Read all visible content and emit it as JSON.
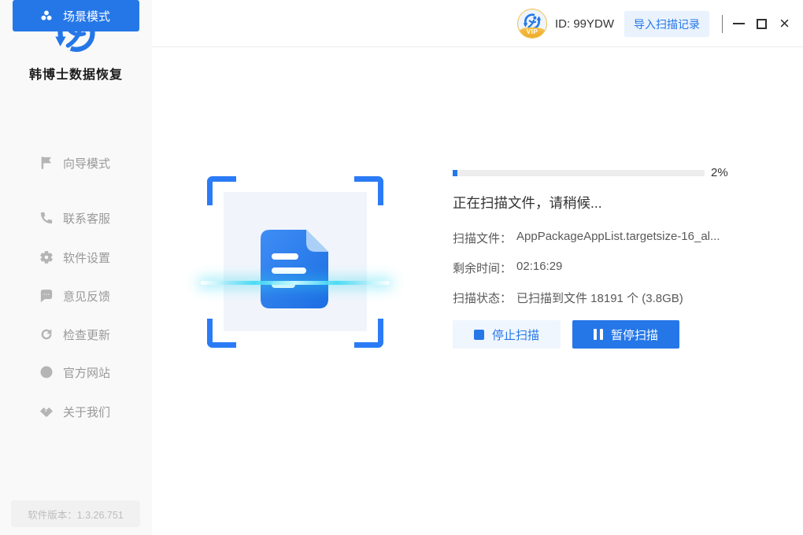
{
  "app": {
    "name": "韩博士数据恢复",
    "version": "软件版本：1.3.26.751"
  },
  "titlebar": {
    "vip_label": "VIP",
    "user_id": "ID: 99YDW",
    "import_scan_button": "导入扫描记录"
  },
  "sidebar": {
    "items": [
      {
        "label": "场景模式",
        "icon": "scene-mode-icon",
        "active": true
      },
      {
        "label": "向导模式",
        "icon": "wizard-mode-icon",
        "active": false
      },
      {
        "label": "联系客服",
        "icon": "contact-support-icon",
        "active": false
      },
      {
        "label": "软件设置",
        "icon": "settings-icon",
        "active": false
      },
      {
        "label": "意见反馈",
        "icon": "feedback-icon",
        "active": false
      },
      {
        "label": "检查更新",
        "icon": "check-update-icon",
        "active": false
      },
      {
        "label": "官方网站",
        "icon": "official-website-icon",
        "active": false
      },
      {
        "label": "关于我们",
        "icon": "about-us-icon",
        "active": false
      }
    ]
  },
  "scan": {
    "progress_value": 2,
    "progress_label": "2%",
    "status_message": "正在扫描文件，请稍候...",
    "rows": [
      {
        "label": "扫描文件：",
        "value": "AppPackageAppList.targetsize-16_al..."
      },
      {
        "label": "剩余时间：",
        "value": "02:16:29"
      },
      {
        "label": "扫描状态：",
        "value": "已扫描到文件 18191 个 (3.8GB)"
      }
    ],
    "stop_button": "停止扫描",
    "pause_button": "暂停扫描"
  },
  "colors": {
    "primary_blue": "#2577e8",
    "bracket_blue": "#2b7bf7",
    "scanline_cyan": "#2fd8f2",
    "vip_gold": "#f0b63a"
  }
}
